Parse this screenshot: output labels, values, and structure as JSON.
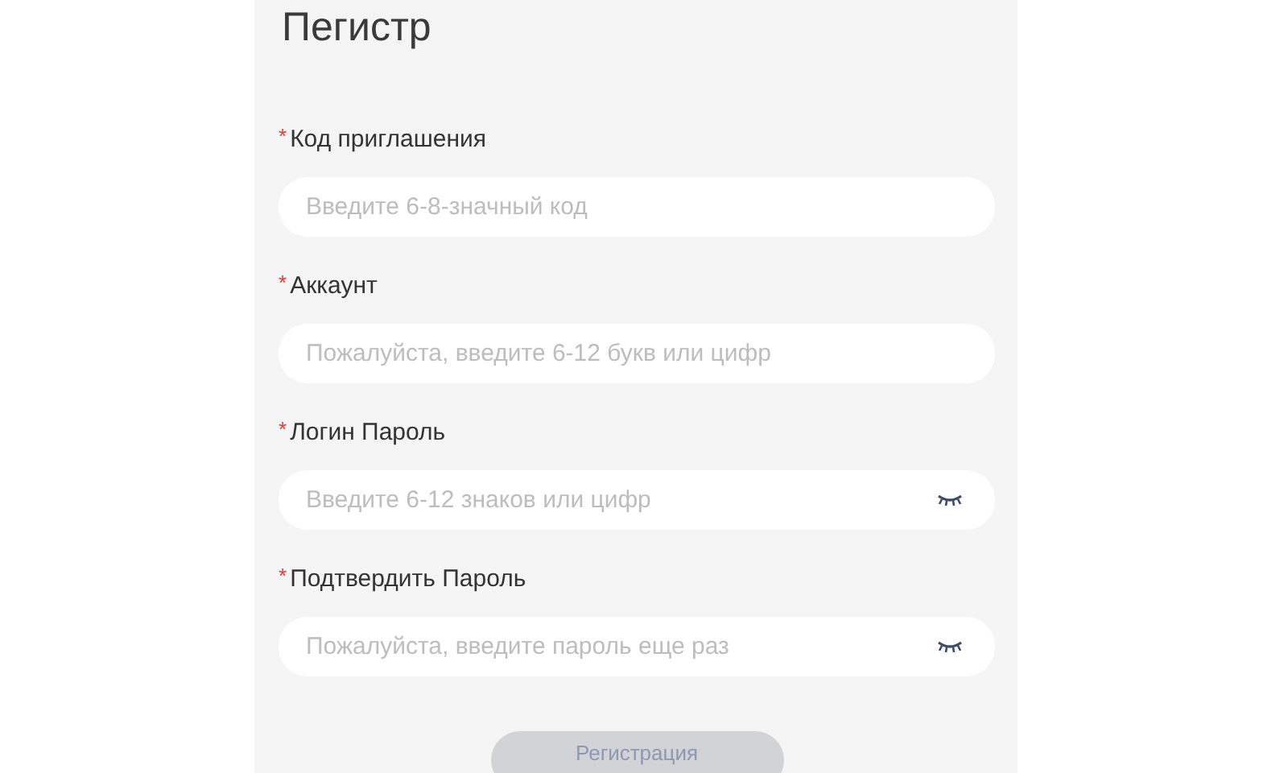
{
  "title": "Пегистр",
  "fields": [
    {
      "mark": "*",
      "label": "Код приглашения",
      "placeholder": "Введите 6-8-значный код",
      "kind": "text"
    },
    {
      "mark": "*",
      "label": "Аккаунт",
      "placeholder": "Пожалуйста, введите 6-12 букв или цифр",
      "kind": "text"
    },
    {
      "mark": "*",
      "label": "Логин Пароль",
      "placeholder": "Введите 6-12 знаков или цифр",
      "kind": "password"
    },
    {
      "mark": "*",
      "label": "Подтвердить Пароль",
      "placeholder": "Пожалуйста, введите пароль еще раз",
      "kind": "password"
    }
  ],
  "submit": {
    "label": "Регистрация",
    "disabled": true
  }
}
